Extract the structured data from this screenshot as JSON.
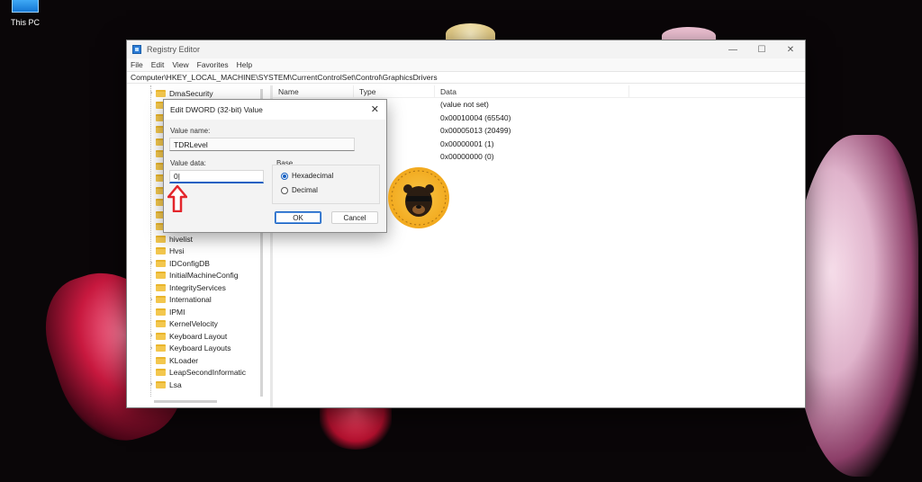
{
  "desktop": {
    "icon_label": "This PC"
  },
  "window": {
    "title": "Registry Editor",
    "controls": {
      "minimize": "—",
      "maximize": "☐",
      "close": "✕"
    },
    "menu": [
      "File",
      "Edit",
      "View",
      "Favorites",
      "Help"
    ],
    "address": "Computer\\HKEY_LOCAL_MACHINE\\SYSTEM\\CurrentControlSet\\Control\\GraphicsDrivers"
  },
  "tree": {
    "items": [
      {
        "label": "DmaSecurity",
        "expander": "›"
      },
      {
        "label": "",
        "expander": ""
      },
      {
        "label": "",
        "expander": ""
      },
      {
        "label": "",
        "expander": ""
      },
      {
        "label": "",
        "expander": ""
      },
      {
        "label": "",
        "expander": ""
      },
      {
        "label": "",
        "expander": ""
      },
      {
        "label": "",
        "expander": ""
      },
      {
        "label": "",
        "expander": ""
      },
      {
        "label": "",
        "expander": ""
      },
      {
        "label": "",
        "expander": ""
      },
      {
        "label": "",
        "expander": ""
      },
      {
        "label": "hivelist",
        "expander": ""
      },
      {
        "label": "Hvsi",
        "expander": ""
      },
      {
        "label": "IDConfigDB",
        "expander": "›"
      },
      {
        "label": "InitialMachineConfig",
        "expander": ""
      },
      {
        "label": "IntegrityServices",
        "expander": ""
      },
      {
        "label": "International",
        "expander": "›"
      },
      {
        "label": "IPMI",
        "expander": ""
      },
      {
        "label": "KernelVelocity",
        "expander": ""
      },
      {
        "label": "Keyboard Layout",
        "expander": "›"
      },
      {
        "label": "Keyboard Layouts",
        "expander": "›"
      },
      {
        "label": "KLoader",
        "expander": ""
      },
      {
        "label": "LeapSecondInformatic",
        "expander": ""
      },
      {
        "label": "Lsa",
        "expander": "›"
      }
    ]
  },
  "list": {
    "headers": {
      "name": "Name",
      "type": "Type",
      "data": "Data"
    },
    "rows": [
      {
        "name": "",
        "type": "",
        "data": "(value not set)"
      },
      {
        "name": "",
        "type": "WORD",
        "data": "0x00010004 (65540)"
      },
      {
        "name": "",
        "type": "WORD",
        "data": "0x00005013 (20499)"
      },
      {
        "name": "",
        "type": "WORD",
        "data": "0x00000001 (1)"
      },
      {
        "name": "",
        "type": "WORD",
        "data": "0x00000000 (0)"
      }
    ]
  },
  "dialog": {
    "title": "Edit DWORD (32-bit) Value",
    "close": "✕",
    "value_name_label": "Value name:",
    "value_name": "TDRLevel",
    "value_data_label": "Value data:",
    "value_data": "0|",
    "base_label": "Base",
    "radio_hex": "Hexadecimal",
    "radio_dec": "Decimal",
    "selected_base": "Hexadecimal",
    "ok_label": "OK",
    "cancel_label": "Cancel"
  },
  "colors": {
    "accent": "#1560c2",
    "annotation_arrow": "#e3262c",
    "folder": "#f3c74e"
  }
}
